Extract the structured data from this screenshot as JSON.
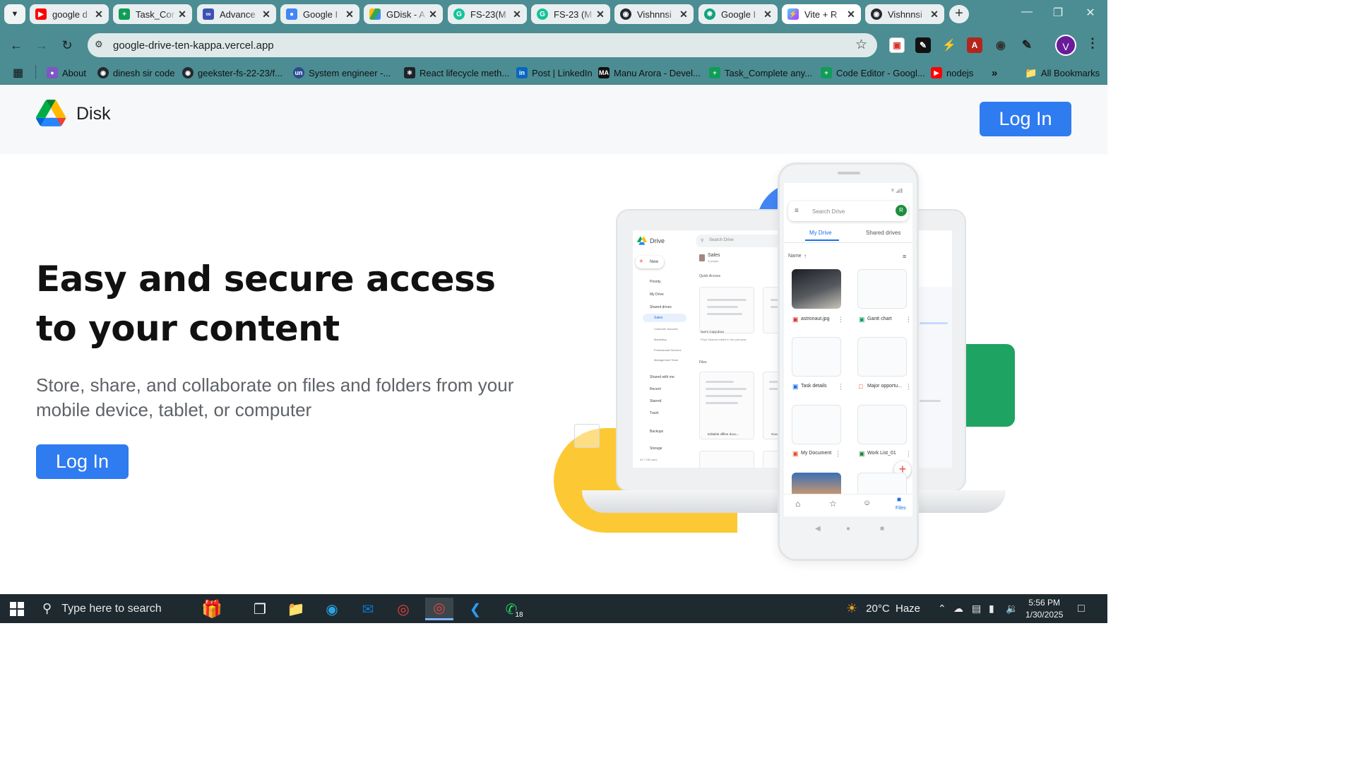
{
  "browser": {
    "tabs": [
      {
        "title": "google d",
        "icon": "youtube-icon",
        "color": "#ff0000",
        "active": false
      },
      {
        "title": "Task_Cor",
        "icon": "sheets-icon",
        "color": "#0f9d58",
        "active": false
      },
      {
        "title": "Advance",
        "icon": "course-icon",
        "color": "#3f51b5",
        "active": false
      },
      {
        "title": "Google I",
        "icon": "contacts-icon",
        "color": "#4285f4",
        "active": false
      },
      {
        "title": "GDisk - A",
        "icon": "drive-icon",
        "color": "#fbbc04",
        "active": false
      },
      {
        "title": "FS-23(M",
        "icon": "grammarly-icon",
        "color": "#15c39a",
        "active": false
      },
      {
        "title": "FS-23 (M",
        "icon": "grammarly-icon",
        "color": "#15c39a",
        "active": false
      },
      {
        "title": "Vishnnsi",
        "icon": "github-icon",
        "color": "#24292f",
        "active": false
      },
      {
        "title": "Google I",
        "icon": "openai-icon",
        "color": "#10a37f",
        "active": false
      },
      {
        "title": "Vite + R",
        "icon": "vite-icon",
        "color": "#a855f7",
        "active": true
      },
      {
        "title": "Vishnnsi",
        "icon": "github-icon",
        "color": "#24292f",
        "active": false
      }
    ],
    "address": "google-drive-ten-kappa.vercel.app",
    "profile_initial": "V",
    "bookmarks": [
      {
        "label": "About",
        "icon": "ai-tool-icon",
        "color": "#7e57c2"
      },
      {
        "label": "dinesh sir code",
        "icon": "github-icon",
        "color": "#24292f"
      },
      {
        "label": "geekster-fs-22-23/f...",
        "icon": "github-icon",
        "color": "#24292f"
      },
      {
        "label": "System engineer -...",
        "icon": "unstop-icon",
        "color": "#2a4d8f"
      },
      {
        "label": "React lifecycle meth...",
        "icon": "react-icon",
        "color": "#20232a"
      },
      {
        "label": "Post | LinkedIn",
        "icon": "linkedin-icon",
        "color": "#0a66c2"
      },
      {
        "label": "Manu Arora - Devel...",
        "icon": "ma-icon",
        "color": "#111111"
      },
      {
        "label": "Task_Complete any...",
        "icon": "sheets-icon",
        "color": "#0f9d58"
      },
      {
        "label": "Code Editor - Googl...",
        "icon": "sheets-icon",
        "color": "#0f9d58"
      },
      {
        "label": "nodejs",
        "icon": "youtube-icon",
        "color": "#ff0000"
      }
    ],
    "all_bookmarks": "All Bookmarks"
  },
  "page": {
    "brand": "Disk",
    "header_login": "Log In",
    "hero_title": "Easy and secure access to your content",
    "hero_subtitle": "Store, share, and collaborate on files and folders from your mobile device, tablet, or computer",
    "hero_login": "Log In"
  },
  "illustration": {
    "laptop": {
      "app": "Drive",
      "search": "Search Drive",
      "new": "New",
      "nav": [
        "Priority",
        "My Drive",
        "Shared drives",
        "Sales",
        "Customer Success",
        "Marketing",
        "Professional Services",
        "Management Team",
        "Shared with me",
        "Recent",
        "Starred",
        "Trash",
        "Backups",
        "Storage"
      ],
      "storage_used": "30.7 GB used",
      "folder": "Sales",
      "folder_sub": "3 people",
      "quick_access": "Quick Access",
      "files": "Files",
      "cards": [
        "Sue's Copy.docx",
        "Editable offline docu...",
        "Google"
      ],
      "card_sub": "Priya Sharma edited in the past year"
    },
    "phone": {
      "search": "Search Drive",
      "avatar": "R",
      "tab_active": "My Drive",
      "tab_other": "Shared drives",
      "sort": "Name",
      "files": [
        "astronaut.jpg",
        "Gantt chart",
        "Task details",
        "Major opportu...",
        "My Document",
        "Work List_01"
      ],
      "nav_active": "Files"
    }
  },
  "taskbar": {
    "search_placeholder": "Type here to search",
    "weather": "20°C  Haze",
    "time": "5:56 PM",
    "date": "1/30/2025",
    "whatsapp_badge": "18"
  },
  "colors": {
    "accent": "#2f7bf0",
    "chrome": "#4b8d93",
    "header_bg": "#f7f8fa"
  }
}
